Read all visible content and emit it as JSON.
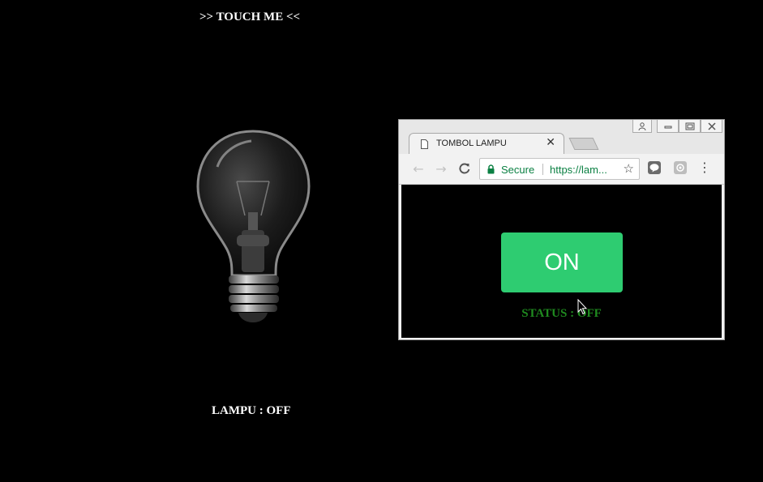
{
  "page": {
    "touch_label": ">> TOUCH ME <<",
    "lampu_status": "LAMPU : OFF"
  },
  "browser": {
    "tab_title": "TOMBOL LAMPU",
    "secure_label": "Secure",
    "url": "https://lam...",
    "button_label": "ON",
    "status": "STATUS : OFF"
  },
  "icons": [
    "page-icon",
    "close-icon",
    "back-icon",
    "forward-icon",
    "reload-icon",
    "lock-icon",
    "star-icon",
    "line-extension-icon",
    "extension-icon",
    "menu-icon",
    "cursor-icon",
    "lightbulb-icon"
  ],
  "colors": {
    "on_button": "#2ecc71",
    "status_text": "#1f8a1f",
    "secure": "#0b8043"
  }
}
